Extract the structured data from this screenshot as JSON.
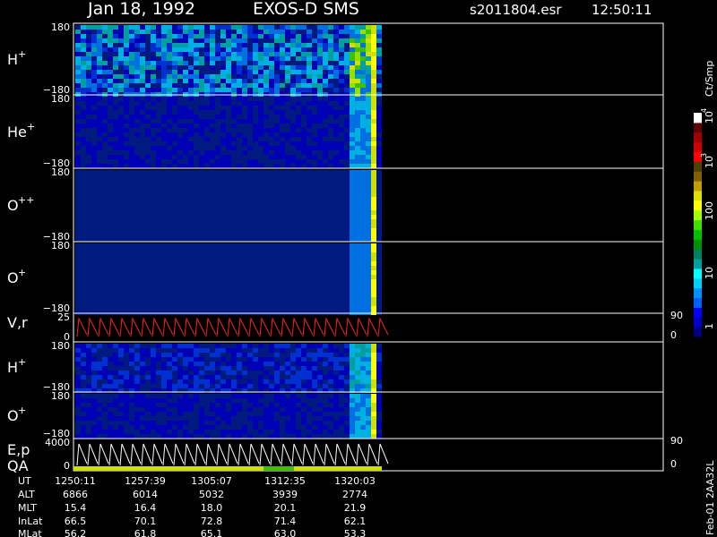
{
  "header": {
    "date": "Jan 18, 1992",
    "instrument": "EXOS-D SMS",
    "file": "s2011804.esr",
    "time": "12:50:11"
  },
  "colorbar": {
    "units": "Ct/Smp",
    "tick_labels": [
      "1",
      "10",
      "100",
      "10",
      "10"
    ],
    "tick_exponents": [
      "",
      "",
      "",
      "3",
      "4"
    ],
    "colors": [
      "#000080",
      "#0000c8",
      "#0000ff",
      "#0060ff",
      "#0090ff",
      "#00d0ff",
      "#00ffff",
      "#00a0a0",
      "#008060",
      "#009000",
      "#00c000",
      "#40e000",
      "#a0ff00",
      "#ffff00",
      "#e0e000",
      "#c0a000",
      "#806000",
      "#504000",
      "#ff0000",
      "#d00000",
      "#a00000",
      "#600000",
      "#ffffff"
    ]
  },
  "panels": [
    {
      "name": "hplus-1",
      "species": "H",
      "charge": "+",
      "ytop": "180",
      "ybot": "−180"
    },
    {
      "name": "heplus",
      "species": "He",
      "charge": "+",
      "ytop": "180",
      "ybot": "−180"
    },
    {
      "name": "oplusplus",
      "species": "O",
      "charge": "++",
      "ytop": "180",
      "ybot": "−180"
    },
    {
      "name": "oplus-1",
      "species": "O",
      "charge": "+",
      "ytop": "180",
      "ybot": "−180"
    },
    {
      "name": "vr",
      "species": "V,r",
      "charge": "",
      "ytop": "25",
      "ybot": "0",
      "right_top": "90",
      "right_bot": "0"
    },
    {
      "name": "hplus-2",
      "species": "H",
      "charge": "+",
      "ytop": "180",
      "ybot": "−180"
    },
    {
      "name": "oplus-2",
      "species": "O",
      "charge": "+",
      "ytop": "180",
      "ybot": "−180"
    },
    {
      "name": "ep",
      "species": "E,p",
      "species2": "QA",
      "charge": "",
      "ytop": "4000",
      "ybot": "0",
      "right_top": "90",
      "right_bot": "0"
    }
  ],
  "table": {
    "row_labels": [
      "UT",
      "ALT",
      "MLT",
      "InLat",
      "MLat"
    ],
    "columns": [
      [
        "1250:11",
        "6866",
        "15.4",
        "66.5",
        "56.2"
      ],
      [
        "1257:39",
        "6014",
        "16.4",
        "70.1",
        "61.8"
      ],
      [
        "1305:07",
        "5032",
        "18.0",
        "72.8",
        "65.1"
      ],
      [
        "1312:35",
        "3939",
        "20.1",
        "71.4",
        "63.0"
      ],
      [
        "1320:03",
        "2774",
        "21.9",
        "62.1",
        "53.3"
      ]
    ]
  },
  "footer_vertical": "Feb-01 2AA32L",
  "chart_data": {
    "type": "heatmap",
    "title": "Jan 18, 1992 EXOS-D SMS",
    "x_ticks": [
      "1250:11",
      "1257:39",
      "1305:07",
      "1312:35",
      "1320:03"
    ],
    "panels": [
      "H+",
      "He+",
      "O++",
      "O+",
      "V,r",
      "H+",
      "O+",
      "E,p QA"
    ],
    "ylim_angle": [
      -180,
      180
    ],
    "colorbar_range": [
      1,
      10000
    ],
    "colorbar_scale": "log",
    "colorbar_units": "Ct/Smp"
  }
}
